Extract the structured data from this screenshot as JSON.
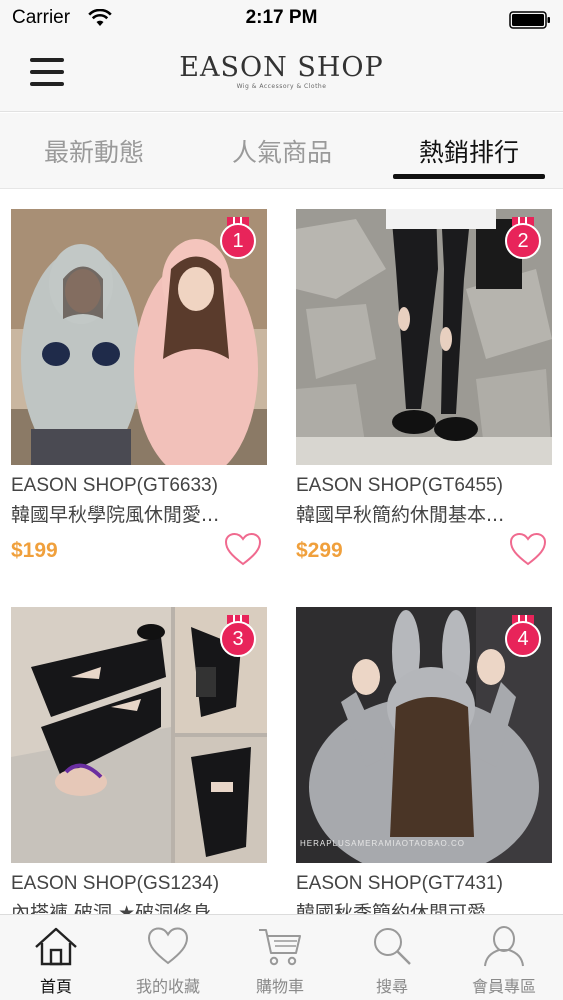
{
  "status_bar": {
    "carrier": "Carrier",
    "time": "2:17 PM"
  },
  "nav": {
    "logo_title": "EASON SHOP",
    "logo_subtitle": "Wig & Accessory & Clothe"
  },
  "tabs": [
    {
      "label": "最新動態",
      "active": false
    },
    {
      "label": "人氣商品",
      "active": false
    },
    {
      "label": "熱銷排行",
      "active": true
    }
  ],
  "products": [
    {
      "rank": "1",
      "code": "EASON SHOP(GT6633)",
      "name": "韓國早秋學院風休閒愛...",
      "price": "$199"
    },
    {
      "rank": "2",
      "code": "EASON SHOP(GT6455)",
      "name": "韓國早秋簡約休閒基本...",
      "price": "$299"
    },
    {
      "rank": "3",
      "code": "EASON SHOP(GS1234)",
      "name": "內搭褲 破洞 ★破洞修身"
    },
    {
      "rank": "4",
      "code": "EASON SHOP(GT7431)",
      "name": "韓國秋季簡約休閒可愛",
      "watermark": "HERAPLUSAMERAMIAOTAOBAO.CO"
    }
  ],
  "bottom_nav": [
    {
      "label": "首頁",
      "icon": "home-icon",
      "active": true
    },
    {
      "label": "我的收藏",
      "icon": "heart-icon",
      "active": false
    },
    {
      "label": "購物車",
      "icon": "cart-icon",
      "active": false
    },
    {
      "label": "搜尋",
      "icon": "search-icon",
      "active": false
    },
    {
      "label": "會員專區",
      "icon": "user-icon",
      "active": false
    }
  ],
  "colors": {
    "accent_pink": "#e8245a",
    "price_orange": "#f0a03c",
    "heart_pink": "#f06a8f"
  }
}
